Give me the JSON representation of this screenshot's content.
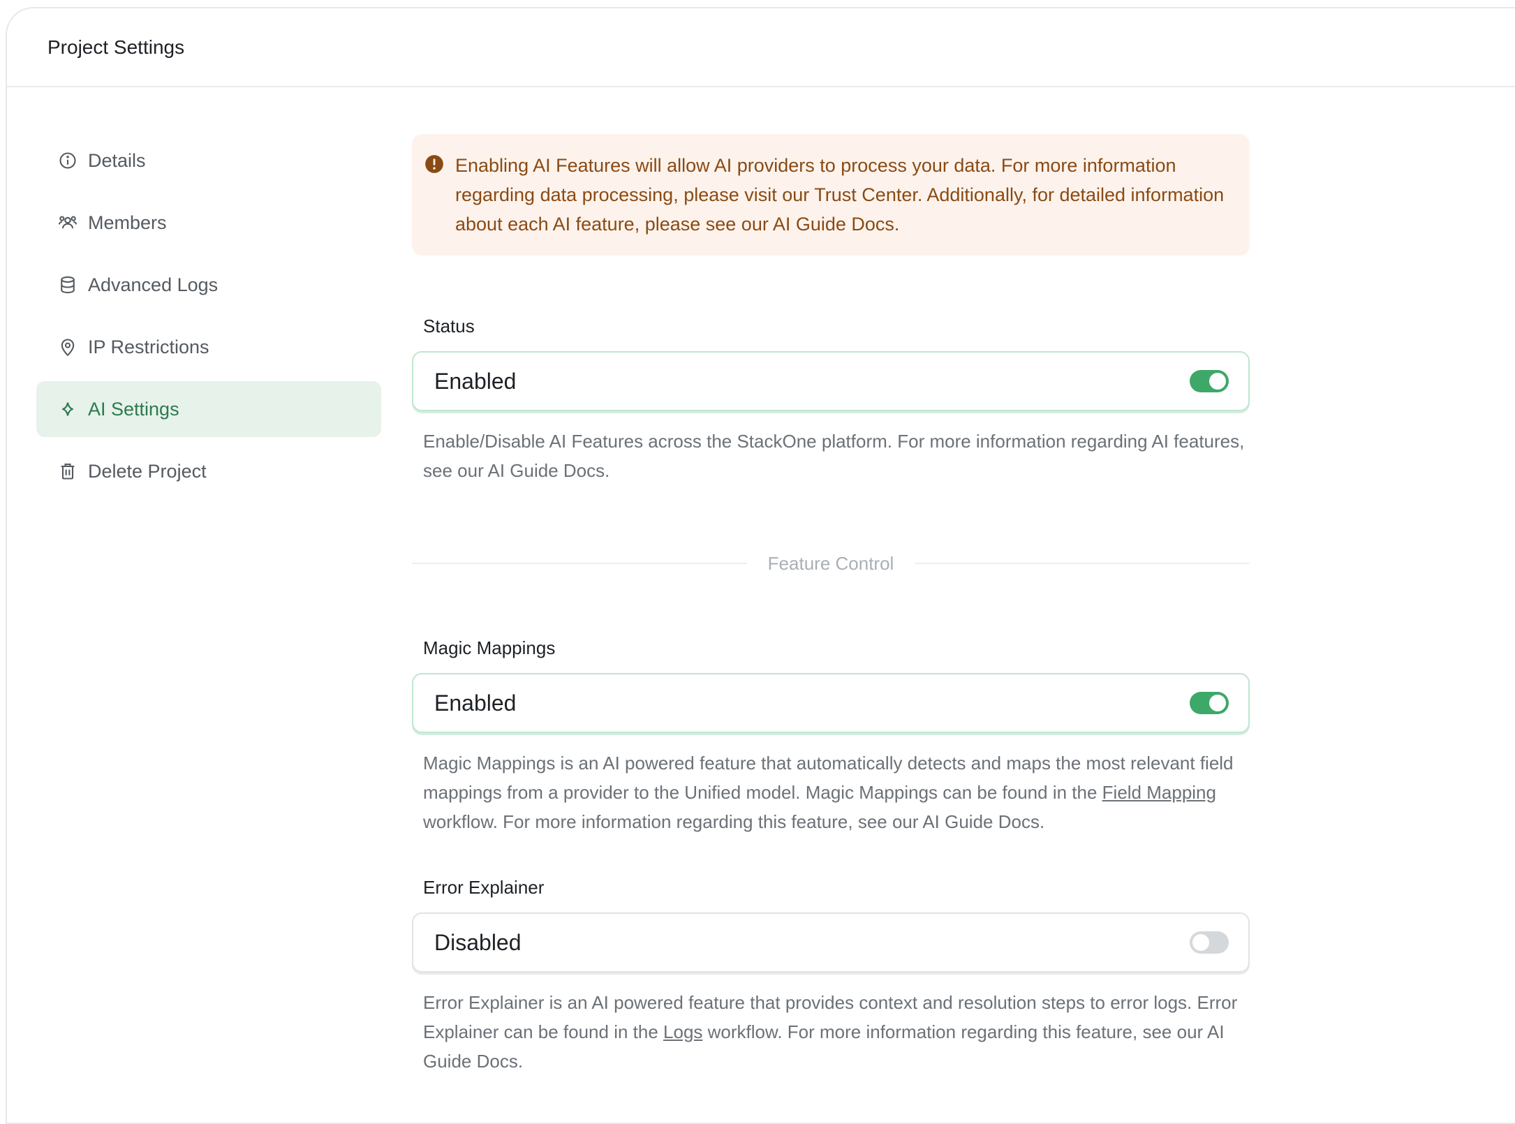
{
  "header": {
    "title": "Project Settings"
  },
  "sidebar": {
    "items": [
      {
        "label": "Details",
        "icon": "info-icon"
      },
      {
        "label": "Members",
        "icon": "users-icon"
      },
      {
        "label": "Advanced Logs",
        "icon": "database-icon"
      },
      {
        "label": "IP Restrictions",
        "icon": "map-pin-icon"
      },
      {
        "label": "AI Settings",
        "icon": "sparkle-icon",
        "active": true
      },
      {
        "label": "Delete Project",
        "icon": "trash-icon"
      }
    ]
  },
  "alert": {
    "text": "Enabling AI Features will allow AI providers to process your data. For more information regarding data processing, please visit our Trust Center. Additionally, for detailed information about each AI feature, please see our AI Guide Docs."
  },
  "status": {
    "label": "Status",
    "value": "Enabled",
    "enabled": true,
    "help": "Enable/Disable AI Features across the StackOne platform. For more information regarding AI features, see our AI Guide Docs."
  },
  "feature_control": {
    "label": "Feature Control"
  },
  "magic_mappings": {
    "label": "Magic Mappings",
    "value": "Enabled",
    "enabled": true,
    "help_before": "Magic Mappings is an AI powered feature that automatically detects and maps the most relevant field mappings from a provider to the Unified model. Magic Mappings can be found in the ",
    "help_link": "Field Mapping",
    "help_after": " workflow. For more information regarding this feature, see our AI Guide Docs."
  },
  "error_explainer": {
    "label": "Error Explainer",
    "value": "Disabled",
    "enabled": false,
    "help_before": "Error Explainer is an AI powered feature that provides context and resolution steps to error logs. Error Explainer can be found in the ",
    "help_link": "Logs",
    "help_after": " workflow. For more information regarding this feature, see our AI Guide Docs."
  },
  "colors": {
    "accent": "#3ea868",
    "active_nav_bg": "#e6f2ea",
    "alert_bg": "#fdf3ec",
    "alert_text": "#8a4a14"
  }
}
